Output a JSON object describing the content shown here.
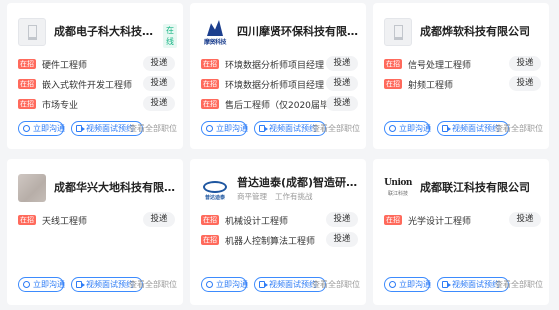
{
  "common": {
    "deliver": "投递",
    "chat": "立即沟通",
    "video": "视频面试预约",
    "more": "查看全部职位",
    "tag": "在招",
    "online": "在线"
  },
  "cards": [
    {
      "company": "成都电子科大科技园发展有...",
      "logo": "placeholder-logo-icon",
      "jobs": [
        "硬件工程师",
        "嵌入式软件开发工程师",
        "市场专业"
      ]
    },
    {
      "company": "四川摩贤环保科技有限公司",
      "logo": "moxian-logo",
      "logo_text": "摩贤科技",
      "jobs": [
        "环境数据分析师项目经理（实习）",
        "环境数据分析师项目经理（储备）",
        "售后工程师（仅2020届毕业..."
      ]
    },
    {
      "company": "成都烨软科技有限公司",
      "logo": "placeholder-logo-icon",
      "jobs": [
        "信号处理工程师",
        "射频工程师"
      ]
    },
    {
      "company": "成都华兴大地科技有限公司",
      "logo": "company-photo",
      "jobs": [
        "天线工程师"
      ]
    },
    {
      "company": "普达迪泰(成都)智造研究院有限...",
      "logo": "pudadt-logo",
      "logo_text": "普达迪泰",
      "meta": [
        "商平管理",
        "工作有挑战"
      ],
      "jobs": [
        "机械设计工程师",
        "机器人控制算法工程师"
      ]
    },
    {
      "company": "成都联江科技有限公司",
      "logo": "union-logo",
      "logo_text": "Union",
      "logo_subtext": "联江科技",
      "jobs": [
        "光学设计工程师"
      ]
    }
  ]
}
